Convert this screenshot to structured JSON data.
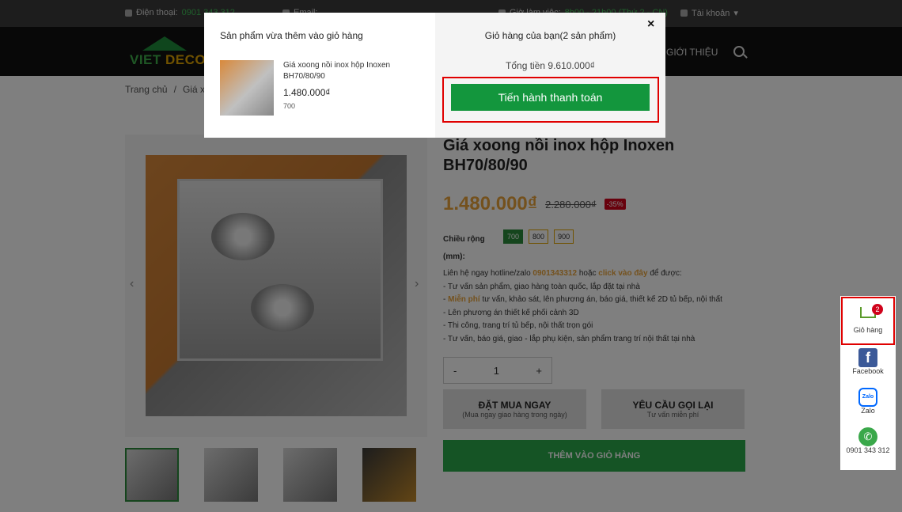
{
  "topbar": {
    "phone_label": "Điện thoại:",
    "phone_value": "0901 343 312",
    "email_label": "Email:",
    "hours_label": "Giờ làm việc:",
    "hours_value": "8h00 - 21h00 (Thứ 2 - CN)",
    "account_label": "Tài khoản"
  },
  "header": {
    "logo_part1": "VIET ",
    "logo_part2": "DECOR",
    "nav_intro": "GIỚI THIỆU"
  },
  "breadcrumb": {
    "home": "Trang chủ",
    "sep": "/",
    "current": "Giá xoo"
  },
  "product": {
    "title": "Giá xoong nồi inox hộp Inoxen BH70/80/90",
    "price": "1.480.000₫",
    "old_price": "2.280.000₫",
    "discount": "-35%",
    "width_label": "Chiều rộng (mm):",
    "width_options": [
      "700",
      "800",
      "900"
    ],
    "selected_width": "700",
    "desc_intro_1": "Liên hệ ngay hotline/zalo ",
    "desc_hotline": "0901343312",
    "desc_intro_2": " hoặc ",
    "desc_click": "click vào đây",
    "desc_intro_3": " để được:",
    "desc_line1": "- Tư vấn sản phẩm, giao hàng toàn quốc, lắp đặt tại nhà",
    "desc_line2_a": "- ",
    "desc_line2_hl": "Miễn phí",
    "desc_line2_b": " tư vấn, khảo sát, lên phương án, báo giá, thiết kế 2D tủ bếp, nội thất",
    "desc_line3": "- Lên phương án thiết kế phối cảnh 3D",
    "desc_line4": "- Thi công, trang trí tủ bếp, nội thất trọn gói",
    "desc_line5": "- Tư vấn, báo giá, giao - lắp phụ kiện, sản phẩm trang trí nội thất tại nhà",
    "qty_minus": "-",
    "qty_value": "1",
    "qty_plus": "+",
    "buy_now": "ĐẶT MUA NGAY",
    "buy_now_sub": "(Mua ngay giao hàng trong ngày)",
    "call_back": "YÊU CẦU GỌI LẠI",
    "call_back_sub": "Tư vấn miễn phí",
    "add_to_cart": "THÊM VÀO GIỎ HÀNG",
    "prev_arrow": "‹",
    "next_arrow": "›"
  },
  "floating": {
    "cart_label": "Giỏ hàng",
    "cart_count": "2",
    "facebook_label": "Facebook",
    "zalo_label": "Zalo",
    "zalo_icon_text": "Zalo",
    "phone_label": "0901 343 312"
  },
  "modal": {
    "left_title": "Sản phẩm vừa thêm vào giỏ hàng",
    "item_name": "Giá xoong nồi inox hộp Inoxen BH70/80/90",
    "item_price": "1.480.000₫",
    "item_variant": "700",
    "right_title": "Giỏ hàng của bạn(2 sản phẩm)",
    "total": "Tổng tiền 9.610.000₫",
    "checkout": "Tiến hành thanh toán",
    "close": "×"
  },
  "colors": {
    "accent_green": "#13963d",
    "price_orange": "#e8a33a",
    "highlight_red": "#e00000"
  }
}
